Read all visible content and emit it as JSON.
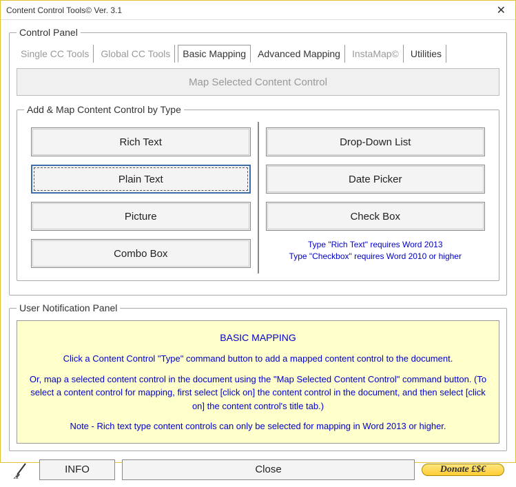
{
  "window": {
    "title": "Content Control Tools© Ver. 3.1",
    "close": "✕"
  },
  "control_panel": {
    "legend": "Control Panel",
    "tabs": [
      {
        "label": "Single CC Tools",
        "state": "disabled"
      },
      {
        "label": "Global CC Tools",
        "state": "disabled"
      },
      {
        "label": "Basic Mapping",
        "state": "active"
      },
      {
        "label": "Advanced Mapping",
        "state": "normal"
      },
      {
        "label": "InstaMap©",
        "state": "disabled"
      },
      {
        "label": "Utilities",
        "state": "normal"
      }
    ],
    "map_selected_label": "Map Selected Content Control",
    "type_group": {
      "legend": "Add & Map Content Control by Type",
      "left": [
        {
          "label": "Rich Text"
        },
        {
          "label": "Plain Text",
          "selected": true
        },
        {
          "label": "Picture"
        },
        {
          "label": "Combo Box"
        }
      ],
      "right": [
        {
          "label": "Drop-Down List"
        },
        {
          "label": "Date Picker"
        },
        {
          "label": "Check Box"
        }
      ],
      "req_note_1": "Type \"Rich Text\" requires Word 2013",
      "req_note_2": "Type \"Checkbox\" requires Word 2010 or higher"
    }
  },
  "notification": {
    "legend": "User Notification Panel",
    "title": "BASIC MAPPING",
    "p1": "Click a Content Control \"Type\" command button to add a mapped content control to the document.",
    "p2": "Or, map a selected content control in the document using the \"Map Selected Content Control\" command button. (To select a content control for mapping, first select [click on] the content control in the document, and then select [click on] the content control's title tab.)",
    "p3": "Note - Rich text type content controls can only be selected for mapping in Word 2013 or higher."
  },
  "footer": {
    "info": "INFO",
    "close": "Close",
    "donate": "Donate £$€"
  }
}
